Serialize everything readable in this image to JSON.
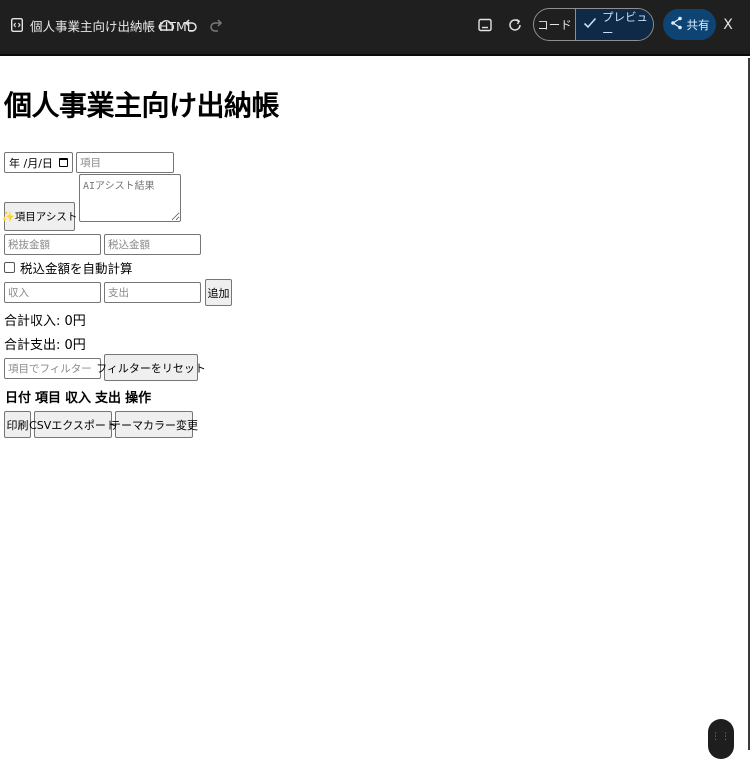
{
  "topbar": {
    "title": "個人事業主向け出納帳 HTML",
    "icons": [
      "code-file-icon",
      "cloud-icon",
      "undo-icon",
      "redo-icon",
      "terminal-icon",
      "refresh-icon",
      "check-icon",
      "share-icon"
    ],
    "mode_code_label": "コード",
    "mode_preview_label": "プレビュー",
    "share_label": "共有",
    "close_label": "X",
    "colors": {
      "bar": "#1f1f1f",
      "preview_active": "#0e2a46",
      "share": "#0e4474"
    }
  },
  "page": {
    "title": "個人事業主向け出納帳"
  },
  "form": {
    "date_value": "年 /月/日",
    "item_placeholder": "項目",
    "ai_assist_label": "✨項目アシスト",
    "ai_result_placeholder": "AIアシスト結果",
    "tax_excluded_placeholder": "税抜金額",
    "tax_included_placeholder": "税込金額",
    "auto_calc_label": "税込金額を自動計算",
    "auto_calc_checked": false,
    "income_placeholder": "収入",
    "expense_placeholder": "支出",
    "add_label": "追加"
  },
  "summary": {
    "total_income": "合計収入: 0円",
    "total_expense": "合計支出: 0円"
  },
  "filter": {
    "placeholder": "項目でフィルター",
    "reset_label": "フィルターをリセット"
  },
  "table": {
    "headers": [
      "日付",
      "項目",
      "収入",
      "支出",
      "操作"
    ],
    "rows": []
  },
  "actions": {
    "print_label": "印刷",
    "csv_label": "CSVエクスポート",
    "theme_label": "テーマカラー変更"
  }
}
